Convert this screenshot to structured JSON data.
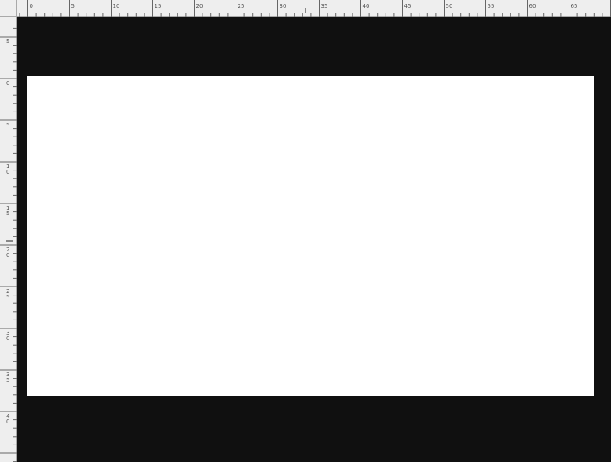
{
  "ruler": {
    "horizontal_labels": [
      "0",
      "5",
      "10",
      "15",
      "20",
      "25",
      "30",
      "35",
      "40",
      "45",
      "50",
      "55",
      "60",
      "65"
    ],
    "vertical_labels": [
      [
        "5"
      ],
      [
        "0"
      ],
      [
        "5"
      ],
      [
        "1",
        "0"
      ],
      [
        "1",
        "5"
      ],
      [
        "2",
        "0"
      ],
      [
        "2",
        "5"
      ],
      [
        "3",
        "0"
      ],
      [
        "3",
        "5"
      ],
      [
        "4",
        "0"
      ]
    ],
    "unit": "cm"
  },
  "colors": {
    "ruler_bg": "#eeeeee",
    "ruler_border": "#a9a9a9",
    "pasteboard": "#101010",
    "document": "#ffffff",
    "tick": "#666666"
  },
  "icons": {
    "ruler_origin": "ruler-origin-icon"
  }
}
